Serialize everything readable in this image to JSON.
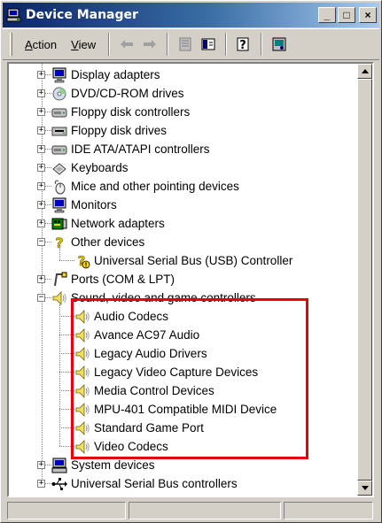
{
  "window": {
    "title": "Device Manager",
    "minimize": "_",
    "maximize": "□",
    "close": "×"
  },
  "menu": {
    "action_prefix": "A",
    "action_rest": "ction",
    "view_prefix": "V",
    "view_rest": "iew"
  },
  "toolbar_icons": [
    "back-arrow-icon",
    "forward-arrow-icon",
    "properties-icon",
    "show-hide-tree-icon",
    "help-icon",
    "scan-hardware-icon"
  ],
  "tree": {
    "categories": [
      {
        "label": "Display adapters",
        "icon": "monitor-icon",
        "state": "collapsed"
      },
      {
        "label": "DVD/CD-ROM drives",
        "icon": "cdrom-icon",
        "state": "collapsed"
      },
      {
        "label": "Floppy disk controllers",
        "icon": "controller-icon",
        "state": "collapsed"
      },
      {
        "label": "Floppy disk drives",
        "icon": "floppy-drive-icon",
        "state": "collapsed"
      },
      {
        "label": "IDE ATA/ATAPI controllers",
        "icon": "controller-icon",
        "state": "collapsed"
      },
      {
        "label": "Keyboards",
        "icon": "keyboard-icon",
        "state": "collapsed"
      },
      {
        "label": "Mice and other pointing devices",
        "icon": "mouse-icon",
        "state": "collapsed"
      },
      {
        "label": "Monitors",
        "icon": "monitor-icon",
        "state": "collapsed"
      },
      {
        "label": "Network adapters",
        "icon": "network-card-icon",
        "state": "collapsed"
      },
      {
        "label": "Other devices",
        "icon": "unknown-device-icon",
        "state": "expanded"
      },
      {
        "label": "Universal Serial Bus (USB) Controller",
        "icon": "unknown-device-warning-icon",
        "state": "child"
      },
      {
        "label": "Ports (COM & LPT)",
        "icon": "port-icon",
        "state": "collapsed"
      },
      {
        "label": "Sound, video and game controllers",
        "icon": "speaker-icon",
        "state": "expanded"
      },
      {
        "label": "Audio Codecs",
        "icon": "speaker-icon",
        "state": "child"
      },
      {
        "label": "Avance AC97 Audio",
        "icon": "speaker-icon",
        "state": "child"
      },
      {
        "label": "Legacy Audio Drivers",
        "icon": "speaker-icon",
        "state": "child"
      },
      {
        "label": "Legacy Video Capture Devices",
        "icon": "speaker-icon",
        "state": "child"
      },
      {
        "label": "Media Control Devices",
        "icon": "speaker-icon",
        "state": "child"
      },
      {
        "label": "MPU-401 Compatible MIDI Device",
        "icon": "speaker-icon",
        "state": "child"
      },
      {
        "label": "Standard Game Port",
        "icon": "speaker-icon",
        "state": "child"
      },
      {
        "label": "Video Codecs",
        "icon": "speaker-icon",
        "state": "child"
      },
      {
        "label": "System devices",
        "icon": "computer-icon",
        "state": "collapsed"
      },
      {
        "label": "Universal Serial Bus controllers",
        "icon": "usb-icon",
        "state": "collapsed"
      }
    ]
  },
  "colors": {
    "highlight_box": "#e8000b",
    "titlebar_start": "#0a246a",
    "titlebar_end": "#a6caf0"
  }
}
